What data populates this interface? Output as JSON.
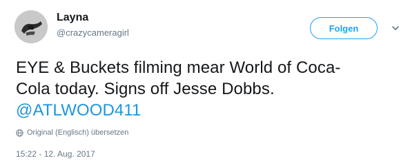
{
  "user": {
    "display_name": "Layna",
    "handle": "@crazycameragirl",
    "avatar_icon": "avatar-photo"
  },
  "follow_button": {
    "label": "Folgen",
    "color": "#1da1f2"
  },
  "menu": {
    "icon": "chevron-down-icon"
  },
  "tweet": {
    "text_line1": "EYE & Buckets filming mear World of Coca-",
    "text_line2": "Cola today. Signs off Jesse Dobbs.",
    "mention": "@ATLWOOD411",
    "mention_color": "#1b95e0"
  },
  "translate": {
    "icon": "globe-icon",
    "label": "Original (Englisch) übersetzen"
  },
  "timestamp": "15:22 - 12. Aug. 2017"
}
